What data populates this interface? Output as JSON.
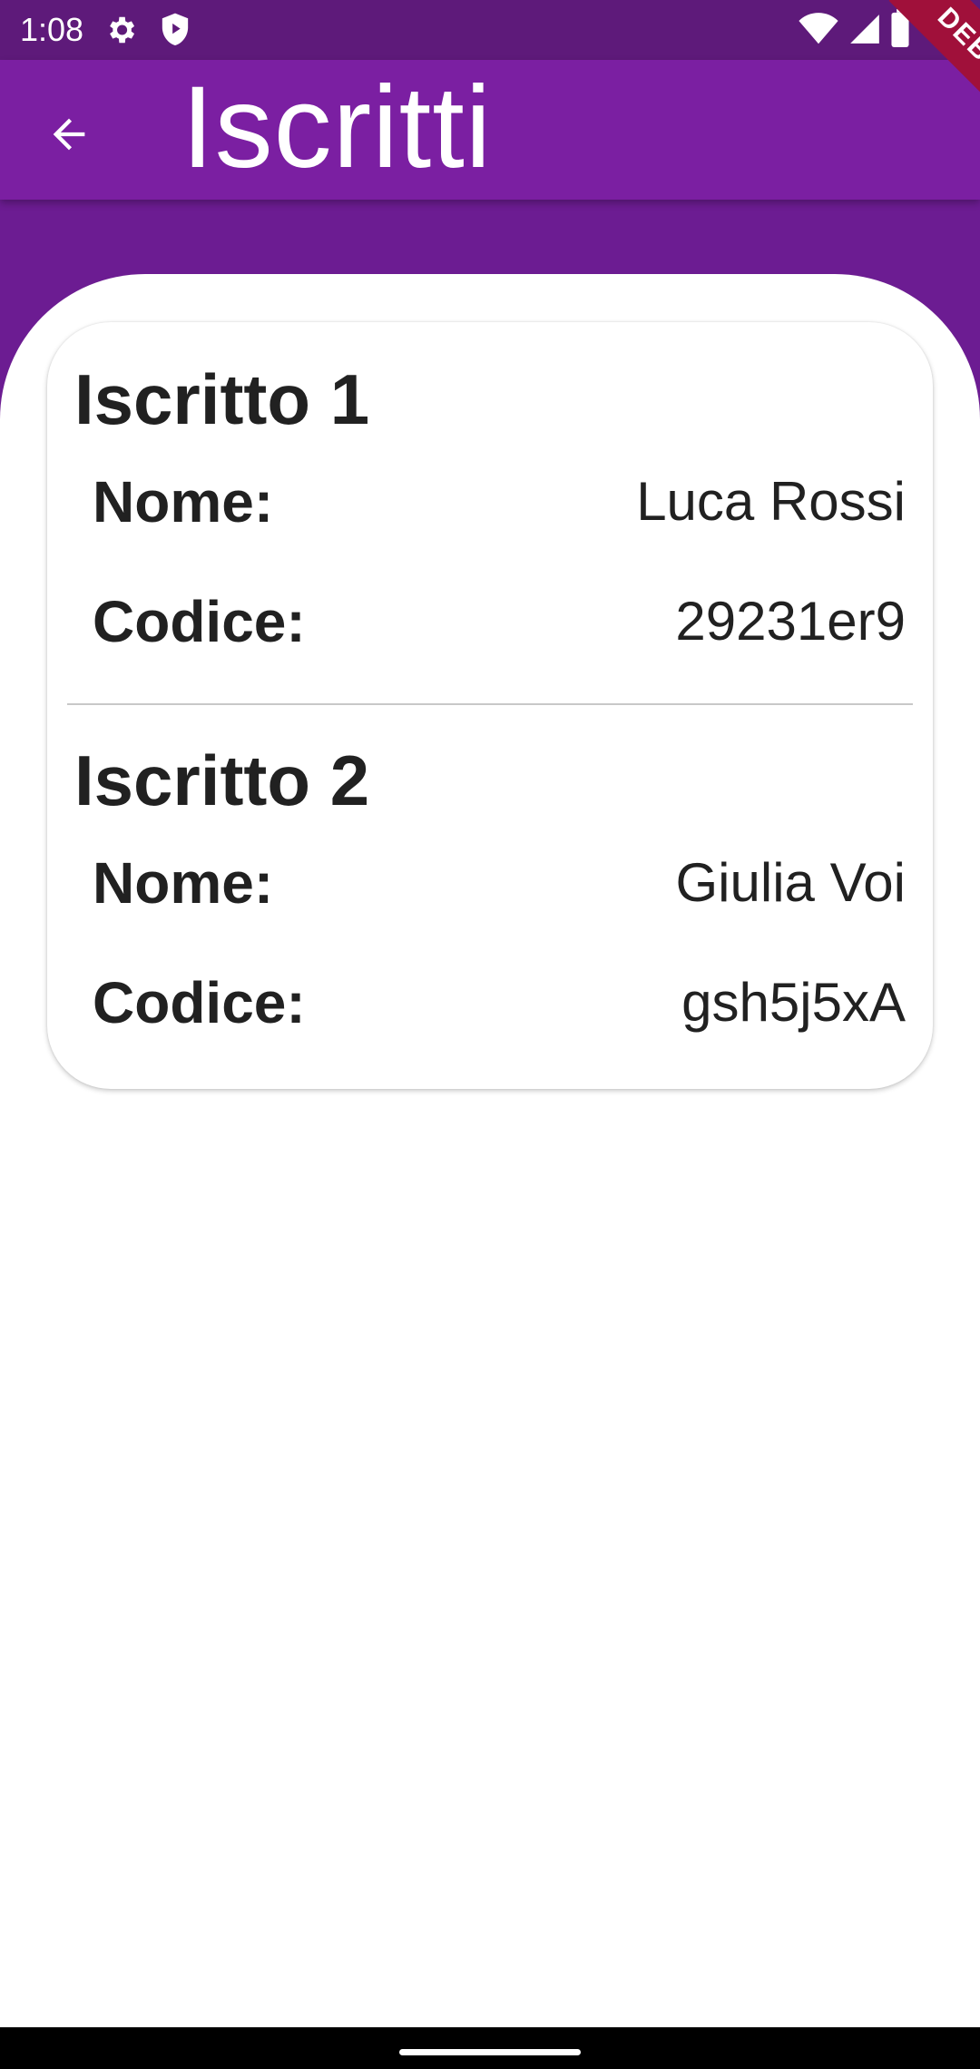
{
  "status_bar": {
    "time": "1:08",
    "icons": [
      "gear-icon",
      "shield-icon",
      "wifi-icon",
      "signal-icon",
      "battery-icon"
    ]
  },
  "app_bar": {
    "title": "Iscritti",
    "back_icon": "arrow-back-icon"
  },
  "debug_banner": "DEBUG",
  "entries": [
    {
      "title": "Iscritto 1",
      "rows": [
        {
          "label": "Nome:",
          "value": "Luca Rossi"
        },
        {
          "label": "Codice:",
          "value": "29231er9"
        }
      ]
    },
    {
      "title": "Iscritto 2",
      "rows": [
        {
          "label": "Nome:",
          "value": "Giulia Voi"
        },
        {
          "label": "Codice:",
          "value": "gsh5j5xA"
        }
      ]
    }
  ],
  "colors": {
    "status_bar": "#5e1a7a",
    "app_bar": "#7b1fa2",
    "header_band": "#6c1c92",
    "debug_banner": "#a0103a"
  }
}
